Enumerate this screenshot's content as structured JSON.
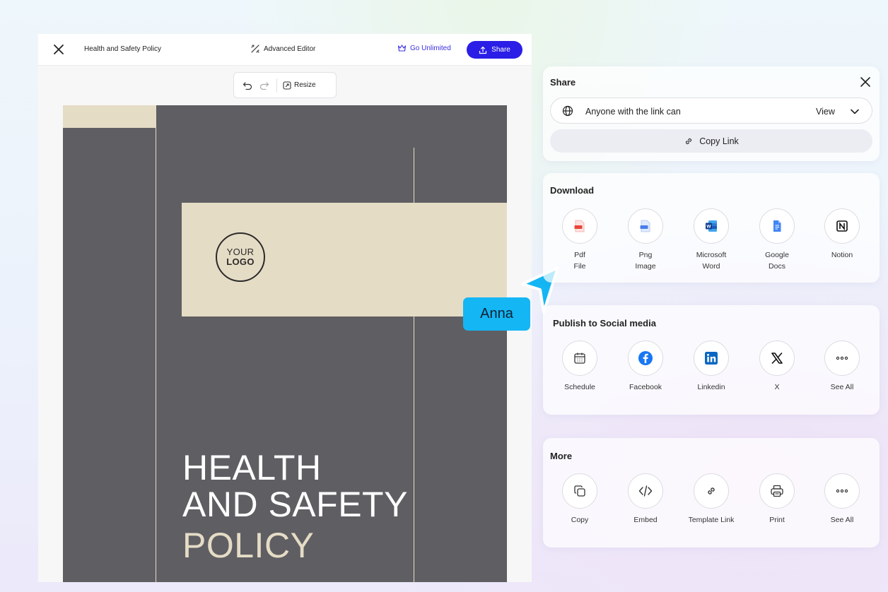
{
  "editor": {
    "doc_title": "Health and Safety Policy",
    "advanced_editor": "Advanced Editor",
    "go_unlimited": "Go Unlimited",
    "share": "Share",
    "resize": "Resize"
  },
  "document": {
    "logo_line1": "YOUR",
    "logo_line2": "LOGO",
    "headline_line1": "HEALTH",
    "headline_line2": "AND SAFETY",
    "headline_line3": "POLICY"
  },
  "collaborator": {
    "name": "Anna",
    "color": "#14b6f4"
  },
  "share_panel": {
    "title": "Share",
    "access_text": "Anyone with the link can",
    "access_permission": "View",
    "copy_link": "Copy Link"
  },
  "download": {
    "title": "Download",
    "items": [
      {
        "line1": "Pdf",
        "line2": "File",
        "icon": "pdf-file-icon"
      },
      {
        "line1": "Png",
        "line2": "Image",
        "icon": "png-image-icon"
      },
      {
        "line1": "Microsoft",
        "line2": "Word",
        "icon": "word-icon"
      },
      {
        "line1": "Google",
        "line2": "Docs",
        "icon": "google-docs-icon"
      },
      {
        "line1": "Notion",
        "line2": "",
        "icon": "notion-icon"
      }
    ]
  },
  "social": {
    "title": "Publish to Social media",
    "items": [
      {
        "label": "Schedule",
        "icon": "calendar-icon"
      },
      {
        "label": "Facebook",
        "icon": "facebook-icon"
      },
      {
        "label": "Linkedin",
        "icon": "linkedin-icon"
      },
      {
        "label": "X",
        "icon": "x-icon"
      },
      {
        "label": "See All",
        "icon": "more-icon"
      }
    ]
  },
  "more": {
    "title": "More",
    "items": [
      {
        "label": "Copy",
        "icon": "copy-icon"
      },
      {
        "label": "Embed",
        "icon": "embed-code-icon"
      },
      {
        "label": "Template Link",
        "icon": "link-icon"
      },
      {
        "label": "Print",
        "icon": "printer-icon"
      },
      {
        "label": "See All",
        "icon": "more-icon"
      }
    ]
  },
  "colors": {
    "accent": "#2b1ee6",
    "canvas_dark": "#5f5e63",
    "canvas_beige": "#e5dcc6"
  }
}
